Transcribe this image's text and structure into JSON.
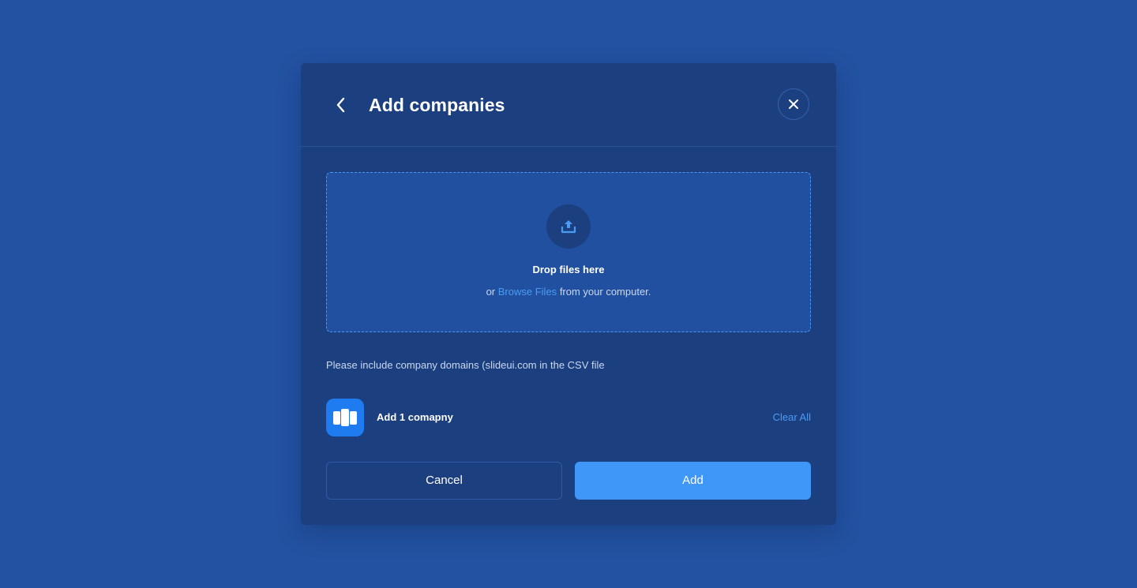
{
  "modal": {
    "title": "Add companies",
    "back_icon": "chevron-left-icon",
    "close_icon": "close-icon"
  },
  "dropzone": {
    "icon": "upload-icon",
    "title": "Drop files here",
    "prefix": "or",
    "link_text": "Browse Files",
    "suffix": "from your computer."
  },
  "hint": "Please include company domains (slideui.com in the CSV file",
  "selection": {
    "logo_icon": "company-logo-icon",
    "label": "Add 1 comapny",
    "clear_label": "Clear All"
  },
  "actions": {
    "cancel_label": "Cancel",
    "add_label": "Add"
  },
  "colors": {
    "background": "#2352a2",
    "modal": "#1c3f80",
    "accent": "#3f97f7",
    "link": "#4a9cf3"
  }
}
